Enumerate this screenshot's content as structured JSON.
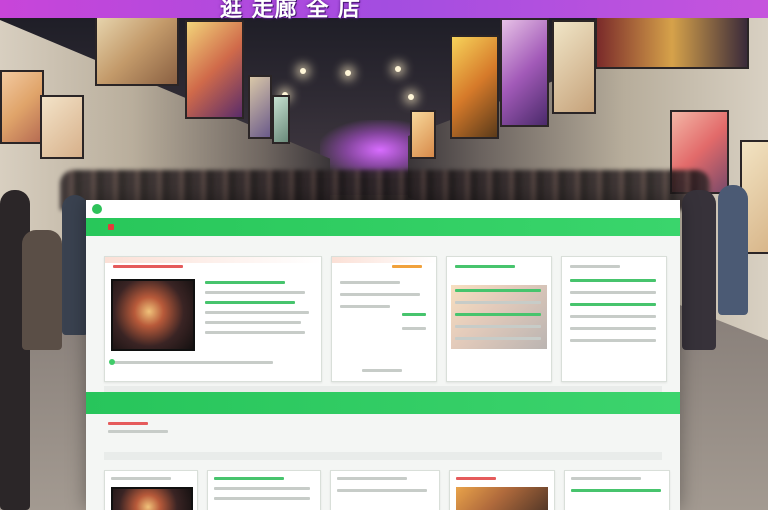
{
  "banner": {
    "title": "逛  走廊  全  店  ",
    "colors": {
      "start": "#c845d9",
      "end": "#a34de0"
    }
  },
  "site": {
    "brand_color": "#2ec25a",
    "top_logo_icon": "leaf-logo-icon"
  },
  "scene": {
    "glow_color": "#d86cff"
  }
}
